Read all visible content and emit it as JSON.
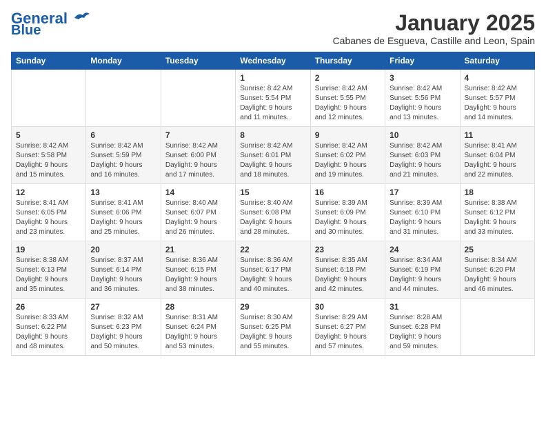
{
  "logo": {
    "line1": "General",
    "line2": "Blue"
  },
  "title": "January 2025",
  "location": "Cabanes de Esgueva, Castille and Leon, Spain",
  "weekdays": [
    "Sunday",
    "Monday",
    "Tuesday",
    "Wednesday",
    "Thursday",
    "Friday",
    "Saturday"
  ],
  "weeks": [
    [
      {
        "day": "",
        "info": ""
      },
      {
        "day": "",
        "info": ""
      },
      {
        "day": "",
        "info": ""
      },
      {
        "day": "1",
        "info": "Sunrise: 8:42 AM\nSunset: 5:54 PM\nDaylight: 9 hours\nand 11 minutes."
      },
      {
        "day": "2",
        "info": "Sunrise: 8:42 AM\nSunset: 5:55 PM\nDaylight: 9 hours\nand 12 minutes."
      },
      {
        "day": "3",
        "info": "Sunrise: 8:42 AM\nSunset: 5:56 PM\nDaylight: 9 hours\nand 13 minutes."
      },
      {
        "day": "4",
        "info": "Sunrise: 8:42 AM\nSunset: 5:57 PM\nDaylight: 9 hours\nand 14 minutes."
      }
    ],
    [
      {
        "day": "5",
        "info": "Sunrise: 8:42 AM\nSunset: 5:58 PM\nDaylight: 9 hours\nand 15 minutes."
      },
      {
        "day": "6",
        "info": "Sunrise: 8:42 AM\nSunset: 5:59 PM\nDaylight: 9 hours\nand 16 minutes."
      },
      {
        "day": "7",
        "info": "Sunrise: 8:42 AM\nSunset: 6:00 PM\nDaylight: 9 hours\nand 17 minutes."
      },
      {
        "day": "8",
        "info": "Sunrise: 8:42 AM\nSunset: 6:01 PM\nDaylight: 9 hours\nand 18 minutes."
      },
      {
        "day": "9",
        "info": "Sunrise: 8:42 AM\nSunset: 6:02 PM\nDaylight: 9 hours\nand 19 minutes."
      },
      {
        "day": "10",
        "info": "Sunrise: 8:42 AM\nSunset: 6:03 PM\nDaylight: 9 hours\nand 21 minutes."
      },
      {
        "day": "11",
        "info": "Sunrise: 8:41 AM\nSunset: 6:04 PM\nDaylight: 9 hours\nand 22 minutes."
      }
    ],
    [
      {
        "day": "12",
        "info": "Sunrise: 8:41 AM\nSunset: 6:05 PM\nDaylight: 9 hours\nand 23 minutes."
      },
      {
        "day": "13",
        "info": "Sunrise: 8:41 AM\nSunset: 6:06 PM\nDaylight: 9 hours\nand 25 minutes."
      },
      {
        "day": "14",
        "info": "Sunrise: 8:40 AM\nSunset: 6:07 PM\nDaylight: 9 hours\nand 26 minutes."
      },
      {
        "day": "15",
        "info": "Sunrise: 8:40 AM\nSunset: 6:08 PM\nDaylight: 9 hours\nand 28 minutes."
      },
      {
        "day": "16",
        "info": "Sunrise: 8:39 AM\nSunset: 6:09 PM\nDaylight: 9 hours\nand 30 minutes."
      },
      {
        "day": "17",
        "info": "Sunrise: 8:39 AM\nSunset: 6:10 PM\nDaylight: 9 hours\nand 31 minutes."
      },
      {
        "day": "18",
        "info": "Sunrise: 8:38 AM\nSunset: 6:12 PM\nDaylight: 9 hours\nand 33 minutes."
      }
    ],
    [
      {
        "day": "19",
        "info": "Sunrise: 8:38 AM\nSunset: 6:13 PM\nDaylight: 9 hours\nand 35 minutes."
      },
      {
        "day": "20",
        "info": "Sunrise: 8:37 AM\nSunset: 6:14 PM\nDaylight: 9 hours\nand 36 minutes."
      },
      {
        "day": "21",
        "info": "Sunrise: 8:36 AM\nSunset: 6:15 PM\nDaylight: 9 hours\nand 38 minutes."
      },
      {
        "day": "22",
        "info": "Sunrise: 8:36 AM\nSunset: 6:17 PM\nDaylight: 9 hours\nand 40 minutes."
      },
      {
        "day": "23",
        "info": "Sunrise: 8:35 AM\nSunset: 6:18 PM\nDaylight: 9 hours\nand 42 minutes."
      },
      {
        "day": "24",
        "info": "Sunrise: 8:34 AM\nSunset: 6:19 PM\nDaylight: 9 hours\nand 44 minutes."
      },
      {
        "day": "25",
        "info": "Sunrise: 8:34 AM\nSunset: 6:20 PM\nDaylight: 9 hours\nand 46 minutes."
      }
    ],
    [
      {
        "day": "26",
        "info": "Sunrise: 8:33 AM\nSunset: 6:22 PM\nDaylight: 9 hours\nand 48 minutes."
      },
      {
        "day": "27",
        "info": "Sunrise: 8:32 AM\nSunset: 6:23 PM\nDaylight: 9 hours\nand 50 minutes."
      },
      {
        "day": "28",
        "info": "Sunrise: 8:31 AM\nSunset: 6:24 PM\nDaylight: 9 hours\nand 53 minutes."
      },
      {
        "day": "29",
        "info": "Sunrise: 8:30 AM\nSunset: 6:25 PM\nDaylight: 9 hours\nand 55 minutes."
      },
      {
        "day": "30",
        "info": "Sunrise: 8:29 AM\nSunset: 6:27 PM\nDaylight: 9 hours\nand 57 minutes."
      },
      {
        "day": "31",
        "info": "Sunrise: 8:28 AM\nSunset: 6:28 PM\nDaylight: 9 hours\nand 59 minutes."
      },
      {
        "day": "",
        "info": ""
      }
    ]
  ]
}
